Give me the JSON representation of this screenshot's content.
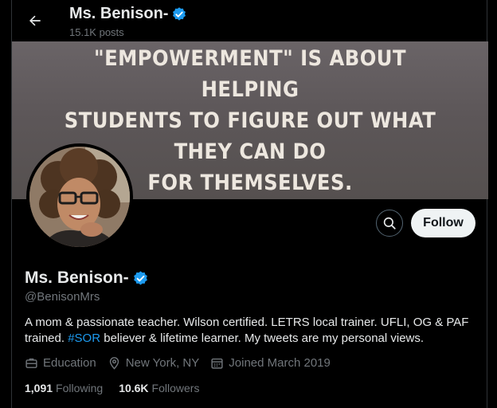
{
  "header": {
    "name": "Ms. Benison-",
    "posts": "15.1K posts"
  },
  "banner": {
    "lines": [
      "\"EMPOWERMENT\" IS ABOUT HELPING",
      "STUDENTS TO FIGURE OUT WHAT THEY CAN DO",
      "FOR THEMSELVES."
    ]
  },
  "actions": {
    "follow_label": "Follow"
  },
  "profile": {
    "name": "Ms. Benison-",
    "handle": "@BenisonMrs",
    "bio_part1": "A mom & passionate teacher. Wilson certified. LETRS local trainer. UFLI, OG & PAF trained. ",
    "bio_hashtag": "#SOR",
    "bio_part2": " believer & lifetime learner. My tweets are my personal views.",
    "category": "Education",
    "location": "New York, NY",
    "joined": "Joined March 2019"
  },
  "stats": {
    "following_count": "1,091",
    "following_label": "Following",
    "followers_count": "10.6K",
    "followers_label": "Followers"
  },
  "colors": {
    "accent": "#1d9bf0",
    "verified": "#1d9bf0",
    "background": "#000000"
  },
  "icons": [
    "back-arrow-icon",
    "verified-badge-icon",
    "search-icon",
    "briefcase-icon",
    "location-pin-icon",
    "calendar-icon"
  ]
}
